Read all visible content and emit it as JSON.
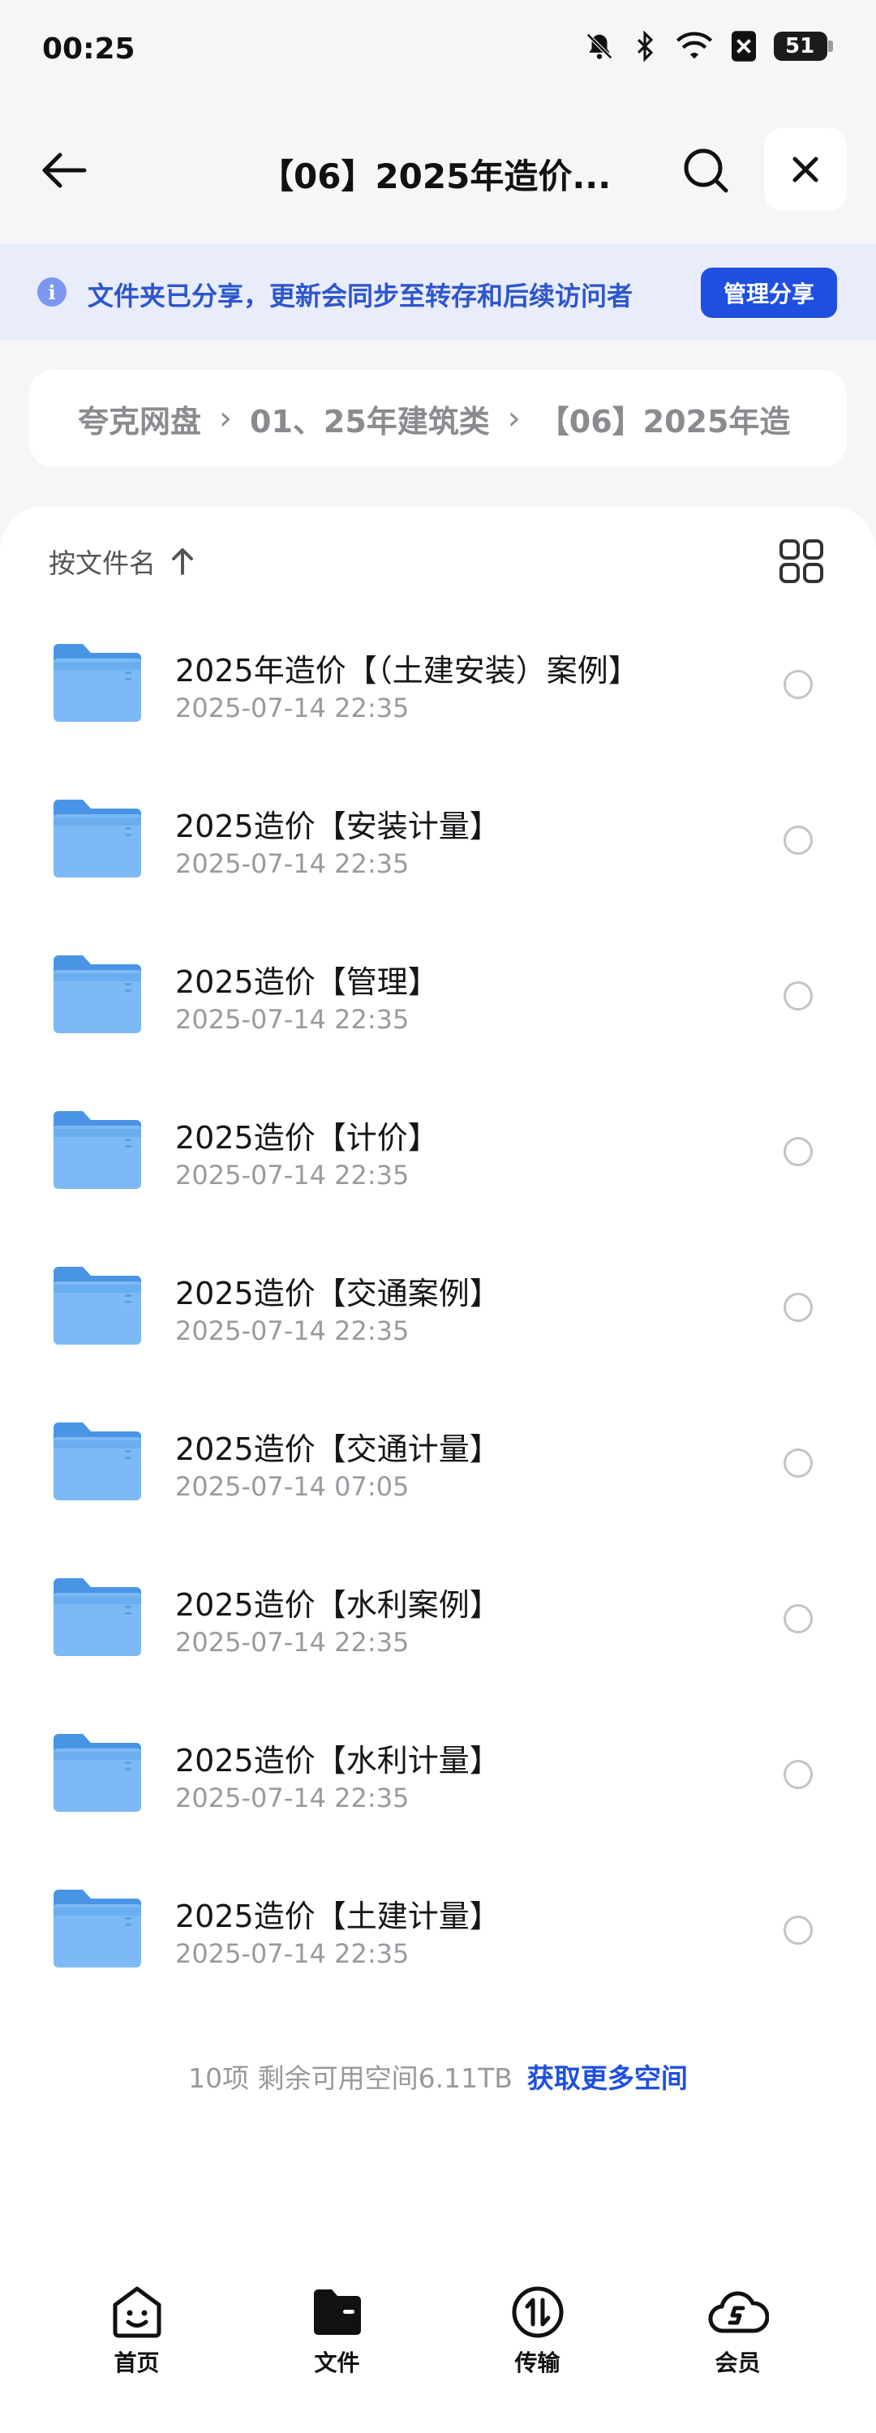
{
  "status_bar": {
    "time": "00:25",
    "battery": "51"
  },
  "header": {
    "title": "【06】2025年造价..."
  },
  "share_banner": {
    "text": "文件夹已分享，更新会同步至转存和后续访问者",
    "button_label": "管理分享"
  },
  "breadcrumb": [
    "夸克网盘",
    "01、25年建筑类",
    "【06】2025年造"
  ],
  "sort": {
    "label": "按文件名"
  },
  "files": [
    {
      "name": "2025年造价【（土建安装）案例】",
      "date": "2025-07-14 22:35"
    },
    {
      "name": "2025造价【安装计量】",
      "date": "2025-07-14 22:35"
    },
    {
      "name": "2025造价【管理】",
      "date": "2025-07-14 22:35"
    },
    {
      "name": "2025造价【计价】",
      "date": "2025-07-14 22:35"
    },
    {
      "name": "2025造价【交通案例】",
      "date": "2025-07-14 22:35"
    },
    {
      "name": "2025造价【交通计量】",
      "date": "2025-07-14 07:05"
    },
    {
      "name": "2025造价【水利案例】",
      "date": "2025-07-14 22:35"
    },
    {
      "name": "2025造价【水利计量】",
      "date": "2025-07-14 22:35"
    },
    {
      "name": "2025造价【土建计量】",
      "date": "2025-07-14 22:35"
    }
  ],
  "footer": {
    "summary": "10项 剩余可用空间6.11TB",
    "link": "获取更多空间"
  },
  "nav": [
    {
      "label": "首页",
      "icon": "home-face-icon"
    },
    {
      "label": "文件",
      "icon": "folder-icon"
    },
    {
      "label": "传输",
      "icon": "transfer-icon"
    },
    {
      "label": "会员",
      "icon": "member-cloud-icon"
    }
  ],
  "colors": {
    "accent": "#1f4fe0",
    "banner_bg": "#e9ecfb",
    "folder": "#6aaef0"
  }
}
